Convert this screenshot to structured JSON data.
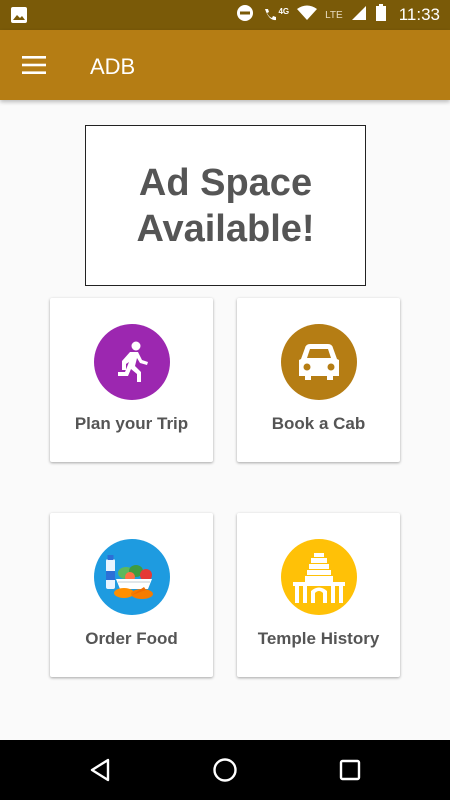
{
  "status_bar": {
    "time": "11:33",
    "network_label": "LTE",
    "call_label": "4G"
  },
  "app_bar": {
    "title": "ADB",
    "menu_icon": "hamburger-menu-icon"
  },
  "ad": {
    "text": "Ad Space Available!"
  },
  "tiles": [
    {
      "label": "Plan your Trip",
      "icon": "running-person-icon",
      "color": "#9c27b0"
    },
    {
      "label": "Book a Cab",
      "icon": "car-icon",
      "color": "#b57d14"
    },
    {
      "label": "Order Food",
      "icon": "food-basket-icon",
      "color": "#1e9be0"
    },
    {
      "label": "Temple History",
      "icon": "temple-icon",
      "color": "#ffc107"
    }
  ],
  "nav_bar": {
    "back_icon": "back-triangle-icon",
    "home_icon": "home-circle-icon",
    "recents_icon": "recents-square-icon"
  }
}
